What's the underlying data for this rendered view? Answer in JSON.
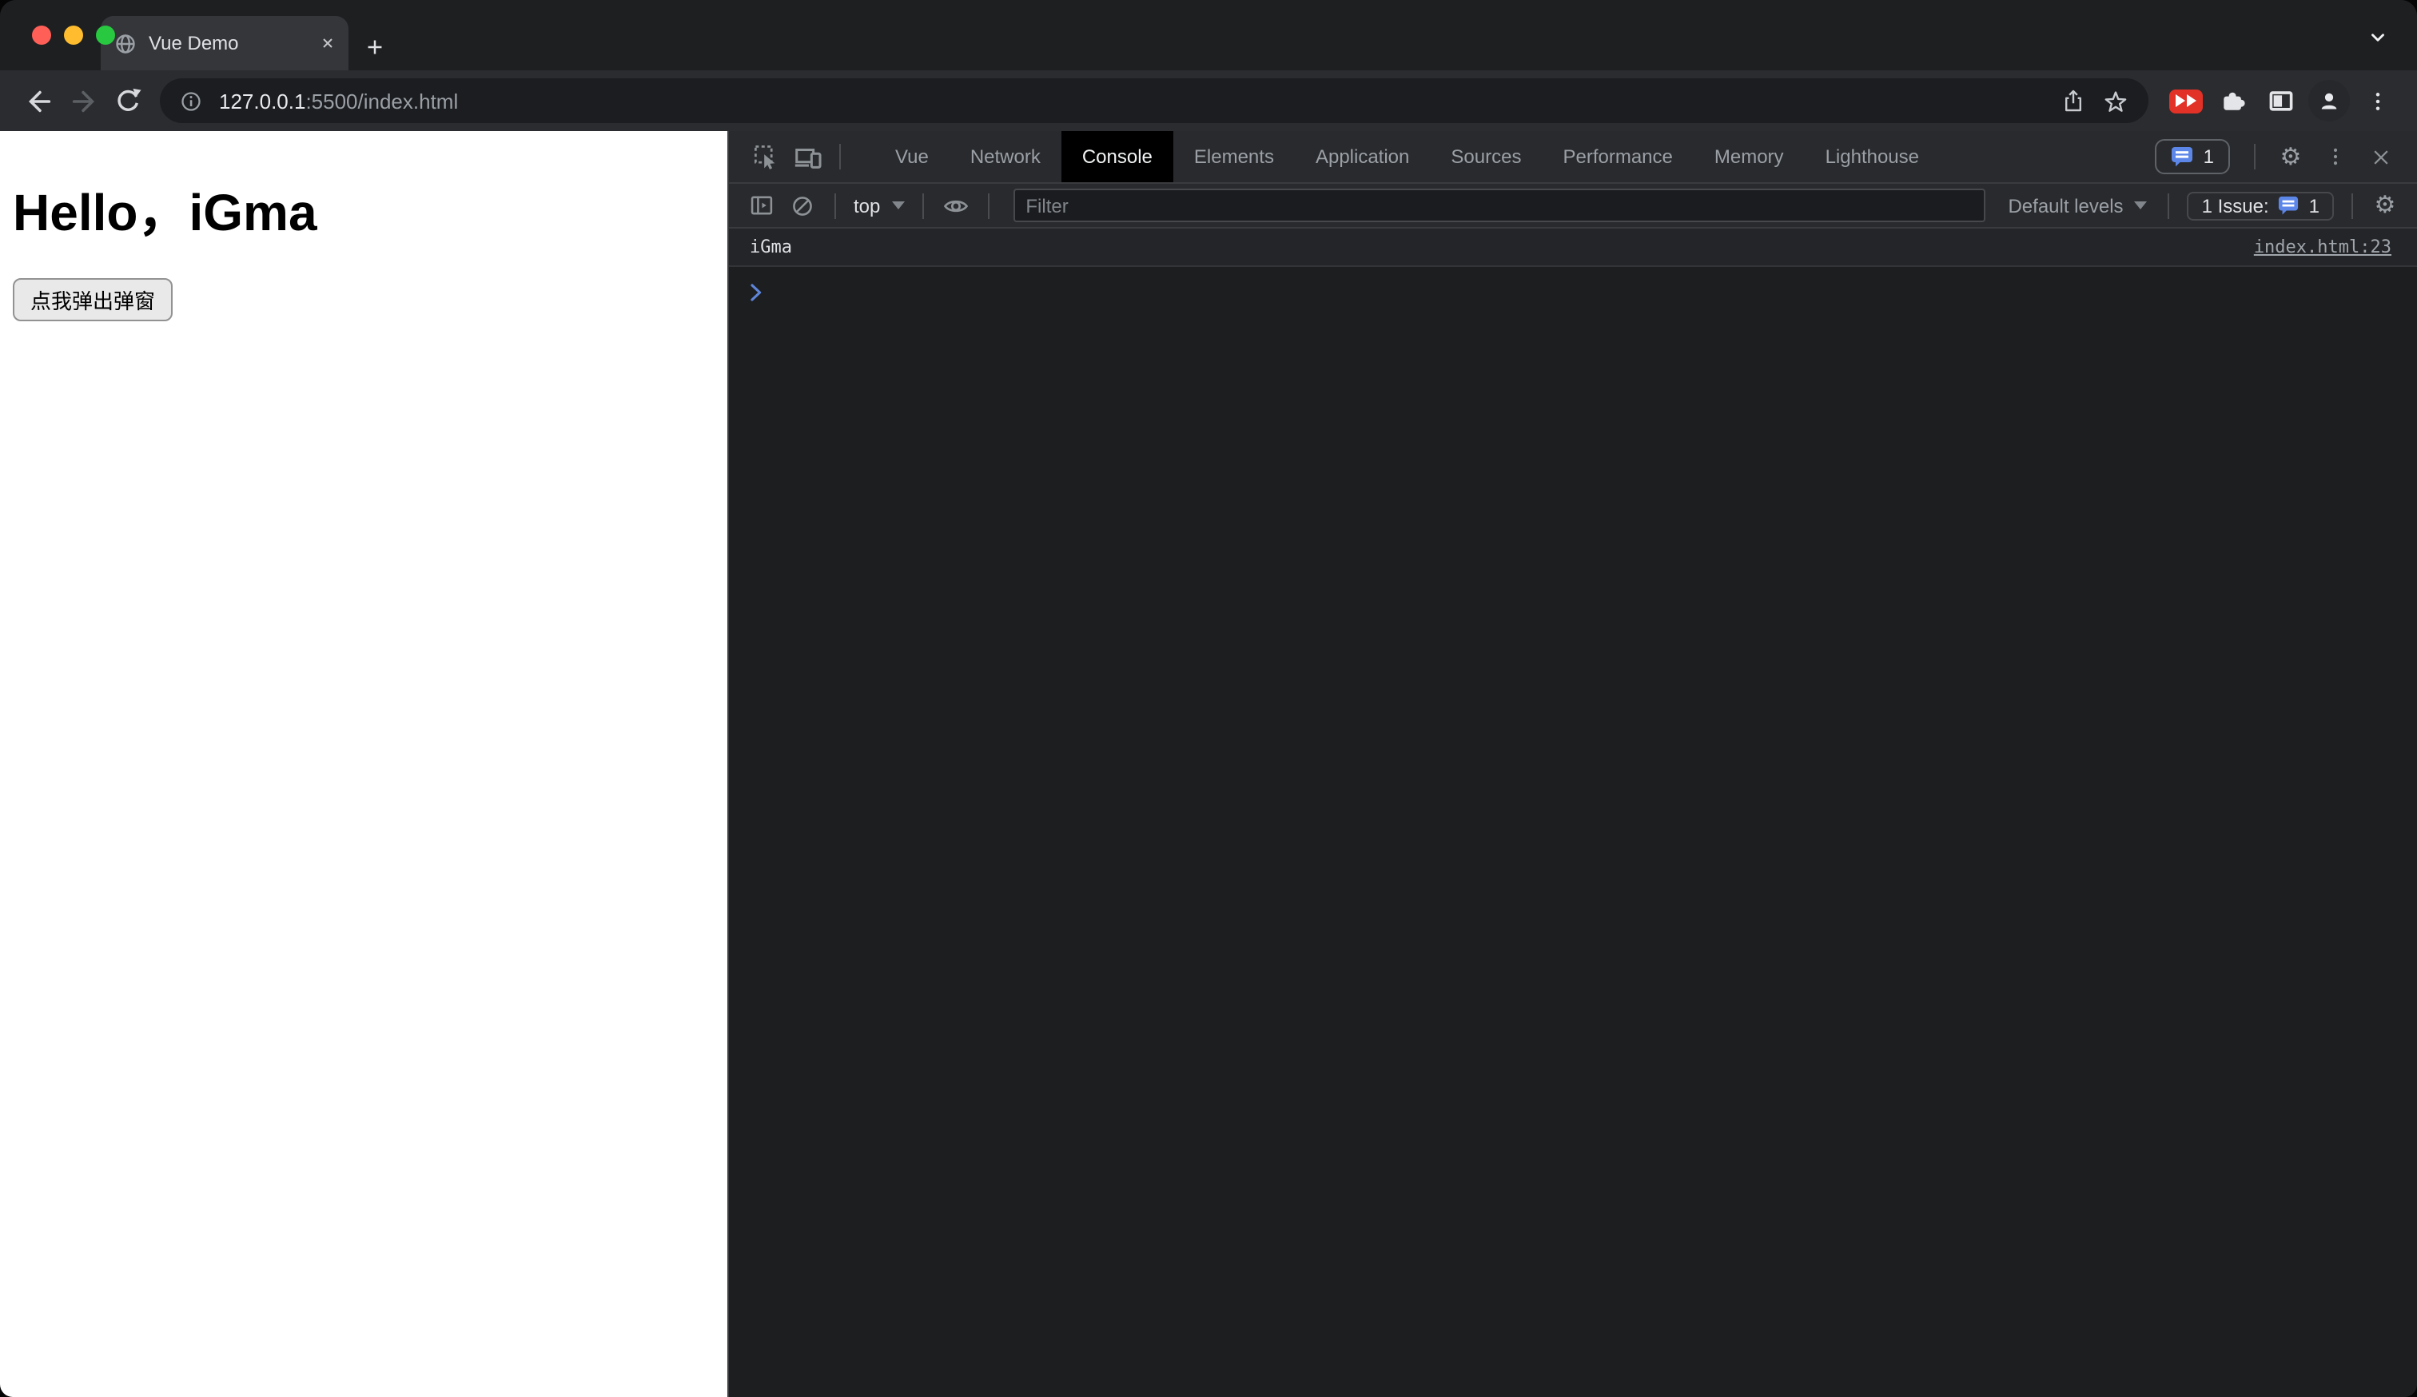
{
  "colors": {
    "traffic_red": "#ff5f57",
    "traffic_yellow": "#febc2e",
    "traffic_green": "#28c840",
    "accent_blue": "#5c87e8",
    "youtube_red": "#e23127",
    "active_devtools_tab_bg": "#000000",
    "prompt_blue": "#5e84d6"
  },
  "browser": {
    "tab_title": "Vue Demo",
    "url": {
      "host": "127.0.0.1",
      "rest": ":5500/index.html"
    }
  },
  "page": {
    "heading": "Hello，iGma",
    "popup_button": "点我弹出弹窗"
  },
  "devtools": {
    "tabs": [
      {
        "label": "Vue"
      },
      {
        "label": "Network"
      },
      {
        "label": "Console"
      },
      {
        "label": "Elements"
      },
      {
        "label": "Application"
      },
      {
        "label": "Sources"
      },
      {
        "label": "Performance"
      },
      {
        "label": "Memory"
      },
      {
        "label": "Lighthouse"
      }
    ],
    "active_tab": "Console",
    "issues_badge": "1",
    "toolbar": {
      "context": "top",
      "filter_placeholder": "Filter",
      "levels": "Default levels",
      "issue_text": "1 Issue:",
      "issue_count": "1"
    },
    "console": {
      "log": "iGma",
      "source_link": "index.html:23"
    }
  },
  "icons": {
    "gear_glyph": "⚙",
    "names": [
      "globe-icon",
      "close-icon",
      "plus-icon",
      "chevron-down-icon",
      "back-icon",
      "forward-icon",
      "reload-icon",
      "info-icon",
      "share-icon",
      "star-icon",
      "youtube-icon",
      "puzzle-icon",
      "side-panel-icon",
      "profile-icon",
      "kebab-menu-icon",
      "inspect-icon",
      "device-toolbar-icon",
      "issues-chat-icon",
      "console-sidebar-icon",
      "clear-console-icon",
      "eye-icon",
      "console-prompt-icon"
    ]
  }
}
